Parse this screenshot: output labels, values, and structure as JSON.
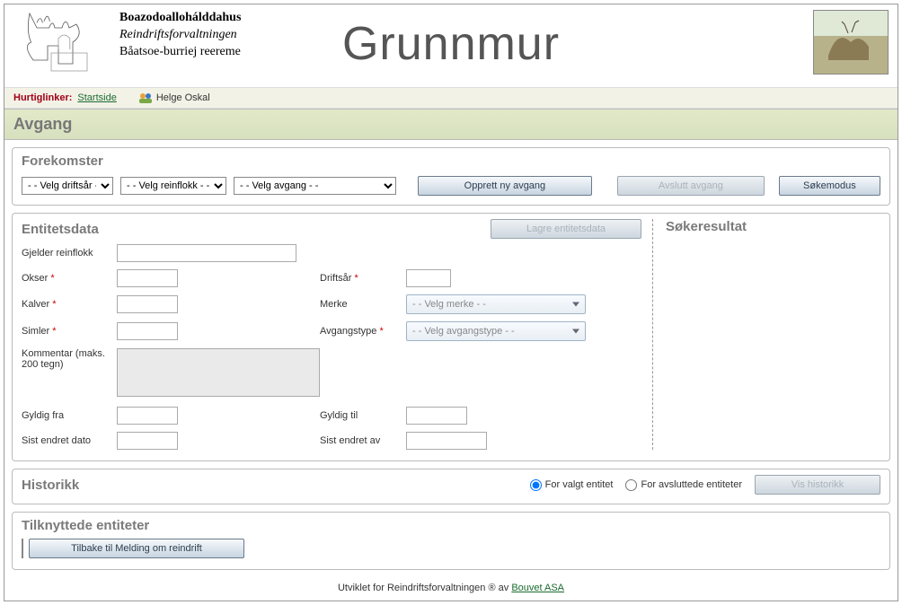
{
  "header": {
    "org1": "Boazodoallohálddahus",
    "org2": "Reindriftsforvaltningen",
    "org3": "Båatsoe-burriej reereme",
    "app_title": "Grunnmur"
  },
  "quicklinks": {
    "label": "Hurtiglinker:",
    "home": "Startside",
    "user": "Helge Oskal"
  },
  "section": {
    "title": "Avgang"
  },
  "forekomster": {
    "title": "Forekomster",
    "sel_driftsar": "- - Velg driftsår - -",
    "sel_reinflokk": "- - Velg reinflokk - -",
    "sel_avgang": "- - Velg avgang - -",
    "btn_opprett": "Opprett ny avgang",
    "btn_avslutt": "Avslutt avgang",
    "btn_sokemodus": "Søkemodus"
  },
  "entitet": {
    "title": "Entitetsdata",
    "btn_lagre": "Lagre entitetsdata",
    "labels": {
      "gjelder": "Gjelder reinflokk",
      "okser": "Okser",
      "kalver": "Kalver",
      "simler": "Simler",
      "kommentar": "Kommentar (maks. 200 tegn)",
      "driftsar": "Driftsår",
      "merke": "Merke",
      "avgangstype": "Avgangstype",
      "gyldig_fra": "Gyldig fra",
      "gyldig_til": "Gyldig til",
      "sist_dato": "Sist endret dato",
      "sist_av": "Sist endret av"
    },
    "dd_merke": "- - Velg merke - -",
    "dd_avgang": "- - Velg avgangstype - -"
  },
  "sokeresultat": {
    "title": "Søkeresultat"
  },
  "historikk": {
    "title": "Historikk",
    "opt_valgt": "For valgt entitet",
    "opt_avsl": "For avsluttede entiteter",
    "btn_vis": "Vis historikk"
  },
  "tilknytt": {
    "title": "Tilknyttede entiteter",
    "btn_back": "Tilbake til Melding om reindrift"
  },
  "footer": {
    "text": "Utviklet for Reindriftsforvaltningen ® av ",
    "link": "Bouvet ASA"
  }
}
